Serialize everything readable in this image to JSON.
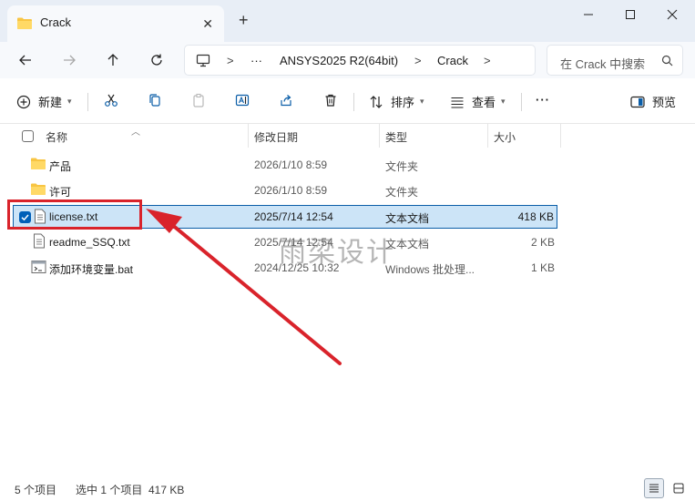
{
  "tab": {
    "title": "Crack",
    "close": "✕",
    "new": "+"
  },
  "window_controls": {
    "minimize": "—",
    "maximize": "☐",
    "close": "✕"
  },
  "address": {
    "more": "···",
    "crumbs": [
      "ANSYS2025 R2(64bit)",
      "Crack"
    ],
    "separator": ">"
  },
  "search": {
    "placeholder": "在 Crack 中搜索"
  },
  "commands": {
    "new": "新建",
    "sort": "排序",
    "view": "查看",
    "preview": "预览",
    "more": "···"
  },
  "columns": {
    "name": "名称",
    "modified": "修改日期",
    "type": "类型",
    "size": "大小"
  },
  "files": [
    {
      "name": "产品",
      "modified": "2026/1/10 8:59",
      "type": "文件夹",
      "size": "",
      "icon": "folder-icon",
      "selected": false
    },
    {
      "name": "许可",
      "modified": "2026/1/10 8:59",
      "type": "文件夹",
      "size": "",
      "icon": "folder-icon",
      "selected": false
    },
    {
      "name": "license.txt",
      "modified": "2025/7/14 12:54",
      "type": "文本文档",
      "size": "418 KB",
      "icon": "text-file-icon",
      "selected": true
    },
    {
      "name": "readme_SSQ.txt",
      "modified": "2025/7/14 12:54",
      "type": "文本文档",
      "size": "2 KB",
      "icon": "text-file-icon",
      "selected": false
    },
    {
      "name": "添加环境变量.bat",
      "modified": "2024/12/25 10:32",
      "type": "Windows 批处理...",
      "size": "1 KB",
      "icon": "batch-file-icon",
      "selected": false
    }
  ],
  "status": {
    "count": "5 个项目",
    "selection": "选中 1 个项目  417 KB"
  },
  "watermark": "雨梁设计",
  "colors": {
    "accent": "#005fb8",
    "selection_bg": "#cce4f7",
    "annotation": "#d9232b",
    "folder": "#f8c543"
  }
}
